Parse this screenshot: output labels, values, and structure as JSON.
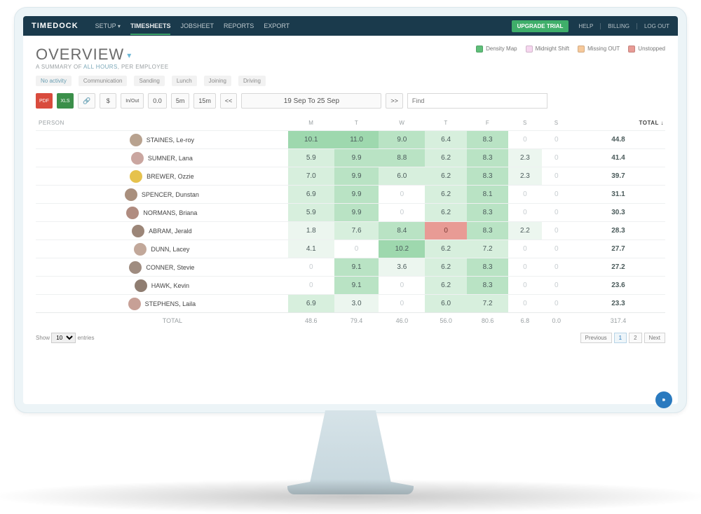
{
  "brand": "TIMEDOCK",
  "nav": {
    "setup": "SETUP",
    "timesheets": "TIMESHEETS",
    "jobsheet": "JOBSHEET",
    "reports": "REPORTS",
    "export": "EXPORT"
  },
  "top_right": {
    "upgrade": "UPGRADE TRIAL",
    "help": "HELP",
    "billing": "BILLING",
    "logout": "LOG OUT"
  },
  "title": "OVERVIEW",
  "subtitle_prefix": "A SUMMARY OF ",
  "subtitle_em": "ALL HOURS",
  "subtitle_suffix": ", PER EMPLOYEE",
  "legend": {
    "density": "Density Map",
    "midnight": "Midnight Shift",
    "missing": "Missing OUT",
    "unstopped": "Unstopped"
  },
  "filter_tabs": [
    "No activity",
    "Communication",
    "Sanding",
    "Lunch",
    "Joining",
    "Driving"
  ],
  "toolbar": {
    "pdf": "PDF",
    "xls": "XLS",
    "link": "🔗",
    "dollar": "$",
    "inout": "In/Out",
    "zero": "0.0",
    "fivem": "5m",
    "fifteenm": "15m",
    "prev": "<<",
    "date_range": "19 Sep To 25 Sep",
    "next": ">>",
    "find_placeholder": "Find"
  },
  "columns": {
    "person": "PERSON",
    "days": [
      "M",
      "T",
      "W",
      "T",
      "F",
      "S",
      "S"
    ],
    "total": "TOTAL ↓"
  },
  "density_levels": {
    "0": "#ffffff",
    "1": "#ecf6ef",
    "2": "#d7efdd",
    "3": "#b9e3c4",
    "4": "#9ed8ae",
    "red": "#e89b95"
  },
  "rows": [
    {
      "name": "STAINES, Le-roy",
      "avatar": "#b8a28f",
      "days": [
        [
          "10.1",
          4
        ],
        [
          "11.0",
          4
        ],
        [
          "9.0",
          3
        ],
        [
          "6.4",
          2
        ],
        [
          "8.3",
          3
        ],
        [
          "0",
          0
        ],
        [
          "0",
          0
        ]
      ],
      "total": "44.8"
    },
    {
      "name": "SUMNER, Lana",
      "avatar": "#caa6a0",
      "days": [
        [
          "5.9",
          2
        ],
        [
          "9.9",
          3
        ],
        [
          "8.8",
          3
        ],
        [
          "6.2",
          2
        ],
        [
          "8.3",
          3
        ],
        [
          "2.3",
          1
        ],
        [
          "0",
          0
        ]
      ],
      "total": "41.4"
    },
    {
      "name": "BREWER, Ozzie",
      "avatar": "#e6c24d",
      "days": [
        [
          "7.0",
          2
        ],
        [
          "9.9",
          3
        ],
        [
          "6.0",
          2
        ],
        [
          "6.2",
          2
        ],
        [
          "8.3",
          3
        ],
        [
          "2.3",
          1
        ],
        [
          "0",
          0
        ]
      ],
      "total": "39.7"
    },
    {
      "name": "SPENCER, Dunstan",
      "avatar": "#a98f7d",
      "days": [
        [
          "6.9",
          2
        ],
        [
          "9.9",
          3
        ],
        [
          "0",
          0
        ],
        [
          "6.2",
          2
        ],
        [
          "8.1",
          3
        ],
        [
          "0",
          0
        ],
        [
          "0",
          0
        ]
      ],
      "total": "31.1"
    },
    {
      "name": "NORMANS, Briana",
      "avatar": "#b08c80",
      "days": [
        [
          "5.9",
          2
        ],
        [
          "9.9",
          3
        ],
        [
          "0",
          0
        ],
        [
          "6.2",
          2
        ],
        [
          "8.3",
          3
        ],
        [
          "0",
          0
        ],
        [
          "0",
          0
        ]
      ],
      "total": "30.3"
    },
    {
      "name": "ABRAM, Jerald",
      "avatar": "#9c8678",
      "days": [
        [
          "1.8",
          1
        ],
        [
          "7.6",
          2
        ],
        [
          "8.4",
          3
        ],
        [
          "0",
          "red"
        ],
        [
          "8.3",
          3
        ],
        [
          "2.2",
          1
        ],
        [
          "0",
          0
        ]
      ],
      "total": "28.3"
    },
    {
      "name": "DUNN, Lacey",
      "avatar": "#c2a89a",
      "days": [
        [
          "4.1",
          1
        ],
        [
          "0",
          0
        ],
        [
          "10.2",
          4
        ],
        [
          "6.2",
          2
        ],
        [
          "7.2",
          2
        ],
        [
          "0",
          0
        ],
        [
          "0",
          0
        ]
      ],
      "total": "27.7"
    },
    {
      "name": "CONNER, Stevie",
      "avatar": "#9f8c80",
      "days": [
        [
          "0",
          0
        ],
        [
          "9.1",
          3
        ],
        [
          "3.6",
          1
        ],
        [
          "6.2",
          2
        ],
        [
          "8.3",
          3
        ],
        [
          "0",
          0
        ],
        [
          "0",
          0
        ]
      ],
      "total": "27.2"
    },
    {
      "name": "HAWK, Kevin",
      "avatar": "#8f7d71",
      "days": [
        [
          "0",
          0
        ],
        [
          "9.1",
          3
        ],
        [
          "0",
          0
        ],
        [
          "6.2",
          2
        ],
        [
          "8.3",
          3
        ],
        [
          "0",
          0
        ],
        [
          "0",
          0
        ]
      ],
      "total": "23.6"
    },
    {
      "name": "STEPHENS, Laila",
      "avatar": "#c7a096",
      "days": [
        [
          "6.9",
          2
        ],
        [
          "3.0",
          1
        ],
        [
          "0",
          0
        ],
        [
          "6.0",
          2
        ],
        [
          "7.2",
          2
        ],
        [
          "0",
          0
        ],
        [
          "0",
          0
        ]
      ],
      "total": "23.3"
    }
  ],
  "totals_row": {
    "label": "TOTAL",
    "days": [
      "48.6",
      "79.4",
      "46.0",
      "56.0",
      "80.6",
      "6.8",
      "0.0"
    ],
    "total": "317.4"
  },
  "footer": {
    "show": "Show",
    "entries": "entries",
    "page_size": "10",
    "pager": {
      "prev": "Previous",
      "p1": "1",
      "p2": "2",
      "next": "Next"
    }
  }
}
